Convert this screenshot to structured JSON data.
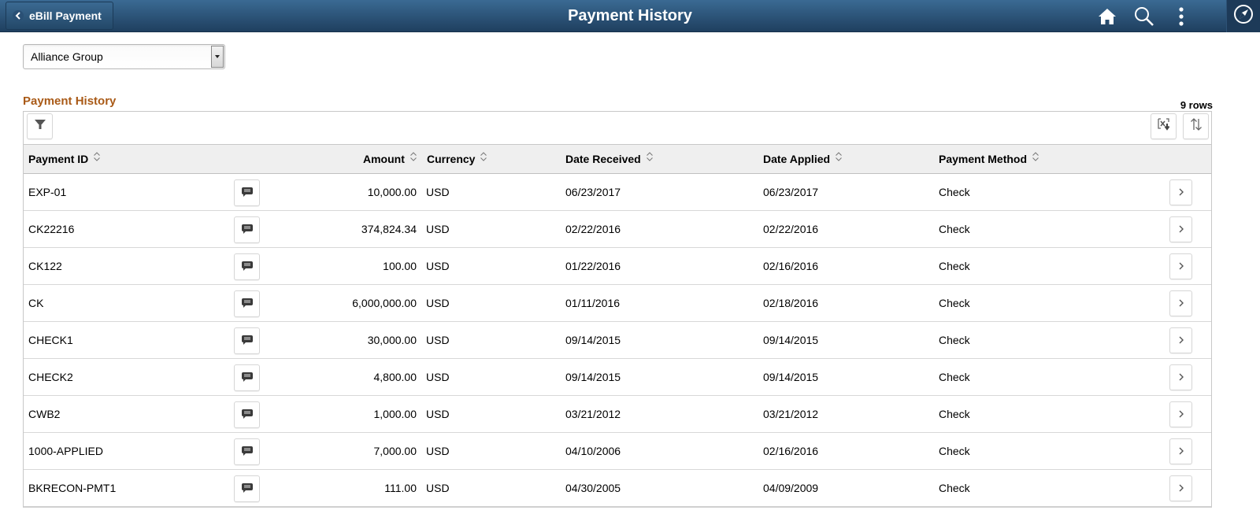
{
  "banner": {
    "back_label": "eBill Payment",
    "title": "Payment History",
    "icons": [
      "home-icon",
      "search-icon",
      "actions-menu-icon",
      "navbar-compass-icon"
    ],
    "colors": {
      "banner_top": "#3a6a93",
      "banner_bottom": "#1f3f5f"
    }
  },
  "selector": {
    "selected": "Alliance Group"
  },
  "grid": {
    "title": "Payment History",
    "title_color": "#a95a17",
    "row_count": "9 rows",
    "toolbar": {
      "filter": "filter-icon",
      "download": "download-to-excel-icon",
      "sort": "sort-icon"
    },
    "columns": [
      "Payment ID",
      "Amount",
      "Currency",
      "Date Received",
      "Date Applied",
      "Payment Method"
    ],
    "rows": [
      {
        "payment_id": "EXP-01",
        "amount": "10,000.00",
        "currency": "USD",
        "date_received": "06/23/2017",
        "date_applied": "06/23/2017",
        "method": "Check"
      },
      {
        "payment_id": "CK22216",
        "amount": "374,824.34",
        "currency": "USD",
        "date_received": "02/22/2016",
        "date_applied": "02/22/2016",
        "method": "Check"
      },
      {
        "payment_id": "CK122",
        "amount": "100.00",
        "currency": "USD",
        "date_received": "01/22/2016",
        "date_applied": "02/16/2016",
        "method": "Check"
      },
      {
        "payment_id": "CK",
        "amount": "6,000,000.00",
        "currency": "USD",
        "date_received": "01/11/2016",
        "date_applied": "02/18/2016",
        "method": "Check"
      },
      {
        "payment_id": "CHECK1",
        "amount": "30,000.00",
        "currency": "USD",
        "date_received": "09/14/2015",
        "date_applied": "09/14/2015",
        "method": "Check"
      },
      {
        "payment_id": "CHECK2",
        "amount": "4,800.00",
        "currency": "USD",
        "date_received": "09/14/2015",
        "date_applied": "09/14/2015",
        "method": "Check"
      },
      {
        "payment_id": "CWB2",
        "amount": "1,000.00",
        "currency": "USD",
        "date_received": "03/21/2012",
        "date_applied": "03/21/2012",
        "method": "Check"
      },
      {
        "payment_id": "1000-APPLIED",
        "amount": "7,000.00",
        "currency": "USD",
        "date_received": "04/10/2006",
        "date_applied": "02/16/2016",
        "method": "Check"
      },
      {
        "payment_id": "BKRECON-PMT1",
        "amount": "111.00",
        "currency": "USD",
        "date_received": "04/30/2005",
        "date_applied": "04/09/2009",
        "method": "Check"
      }
    ]
  }
}
